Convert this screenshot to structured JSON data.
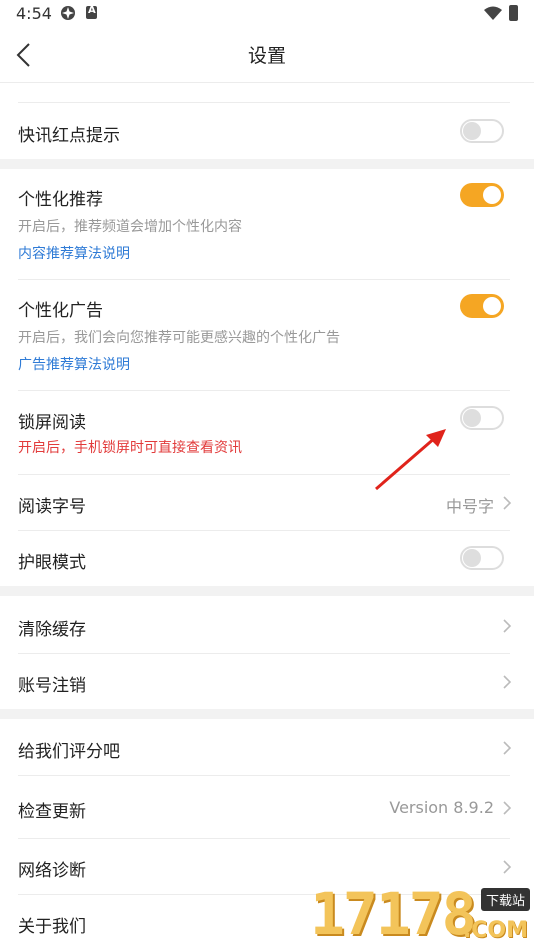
{
  "status_bar": {
    "time": "4:54"
  },
  "header": {
    "title": "设置"
  },
  "rows": {
    "news_red_dot": {
      "label": "快讯红点提示",
      "toggle": "off"
    },
    "personal_rec": {
      "label": "个性化推荐",
      "desc": "开启后，推荐频道会增加个性化内容",
      "link": "内容推荐算法说明",
      "toggle": "on"
    },
    "personal_ad": {
      "label": "个性化广告",
      "desc": "开启后，我们会向您推荐可能更感兴趣的个性化广告",
      "link": "广告推荐算法说明",
      "toggle": "on"
    },
    "lock_read": {
      "label": "锁屏阅读",
      "desc": "开启后，手机锁屏时可直接查看资讯",
      "toggle": "off"
    },
    "font_size": {
      "label": "阅读字号",
      "value": "中号字"
    },
    "eye_mode": {
      "label": "护眼模式",
      "toggle": "off"
    },
    "clear_cache": {
      "label": "清除缓存"
    },
    "cancel_account": {
      "label": "账号注销"
    },
    "rate_us": {
      "label": "给我们评分吧"
    },
    "check_update": {
      "label": "检查更新",
      "value": "Version 8.9.2"
    },
    "network_diag": {
      "label": "网络诊断"
    },
    "about_us": {
      "label": "关于我们"
    }
  },
  "watermark": {
    "number": "17178",
    "tag": "下载站",
    "domain": ".COM"
  },
  "colors": {
    "accent": "#f5a623",
    "link": "#2f7bd6",
    "warning": "#e23b3b",
    "arrow": "#e0231b"
  }
}
